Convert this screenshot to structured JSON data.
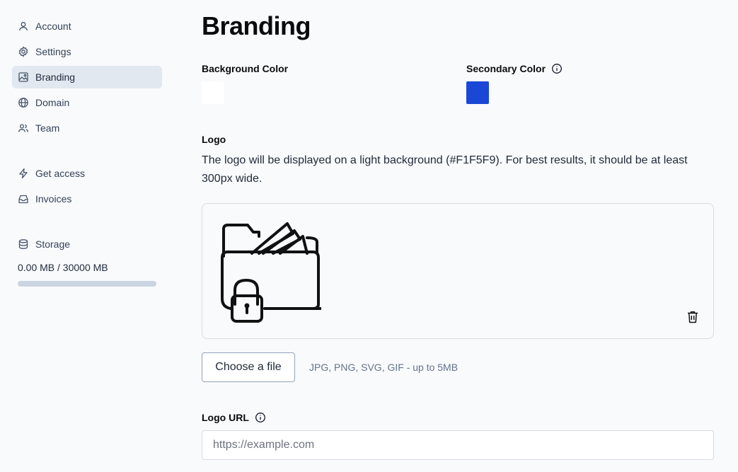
{
  "sidebar": {
    "items": [
      {
        "label": "Account",
        "icon": "user-icon"
      },
      {
        "label": "Settings",
        "icon": "gear-icon"
      },
      {
        "label": "Branding",
        "icon": "image-icon",
        "active": true
      },
      {
        "label": "Domain",
        "icon": "globe-icon"
      },
      {
        "label": "Team",
        "icon": "users-icon"
      },
      {
        "label": "Get access",
        "icon": "lightning-icon"
      },
      {
        "label": "Invoices",
        "icon": "inbox-icon"
      },
      {
        "label": "Storage",
        "icon": "database-icon"
      }
    ],
    "storage": {
      "usage_text": "0.00 MB / 30000 MB",
      "used_fraction": 0
    }
  },
  "main": {
    "title": "Branding",
    "background_color": {
      "label": "Background Color",
      "value": "#FFFFFF"
    },
    "secondary_color": {
      "label": "Secondary Color",
      "value": "#1A47D5"
    },
    "logo": {
      "label": "Logo",
      "help": "The logo will be displayed on a light background (#F1F5F9). For best results, it should be at least 300px wide.",
      "choose_file_label": "Choose a file",
      "file_hint": "JPG, PNG, SVG, GIF - up to 5MB"
    },
    "logo_url": {
      "label": "Logo URL",
      "placeholder": "https://example.com",
      "value": ""
    }
  }
}
